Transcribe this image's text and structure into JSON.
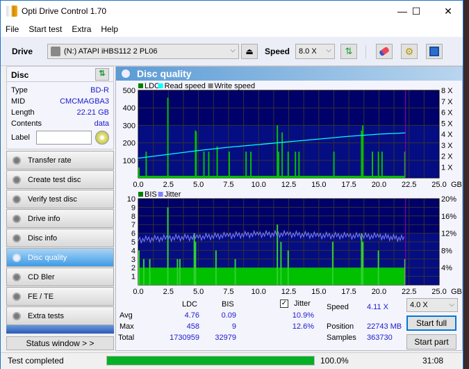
{
  "window": {
    "title": "Opti Drive Control 1.70",
    "minimize": "—",
    "maximize": "☐",
    "close": "✕"
  },
  "menu": [
    "File",
    "Start test",
    "Extra",
    "Help"
  ],
  "toolbar": {
    "drive_label": "Drive",
    "drive_value": "(N:)  ATAPI iHBS112   2 PL06",
    "speed_label": "Speed",
    "speed_value": "8.0 X"
  },
  "disc": {
    "header": "Disc",
    "rows": [
      {
        "k": "Type",
        "v": "BD-R"
      },
      {
        "k": "MID",
        "v": "CMCMAGBA3"
      },
      {
        "k": "Length",
        "v": "22.21 GB"
      },
      {
        "k": "Contents",
        "v": "data"
      }
    ],
    "label_caption": "Label",
    "label_value": ""
  },
  "nav": [
    {
      "label": "Transfer rate",
      "active": false
    },
    {
      "label": "Create test disc",
      "active": false
    },
    {
      "label": "Verify test disc",
      "active": false
    },
    {
      "label": "Drive info",
      "active": false
    },
    {
      "label": "Disc info",
      "active": false
    },
    {
      "label": "Disc quality",
      "active": true
    },
    {
      "label": "CD Bler",
      "active": false
    },
    {
      "label": "FE / TE",
      "active": false
    },
    {
      "label": "Extra tests",
      "active": false
    }
  ],
  "status_window_button": "Status window > >",
  "panel": {
    "title": "Disc quality"
  },
  "chart_data": [
    {
      "type": "bar",
      "title": "LDC",
      "legend": [
        {
          "name": "LDC",
          "color": "#008000"
        },
        {
          "name": "Read speed",
          "color": "#00ffff"
        },
        {
          "name": "Write speed",
          "color": "#808080"
        }
      ],
      "xlabel": "GB",
      "x_ticks": [
        "0.0",
        "2.5",
        "5.0",
        "7.5",
        "10.0",
        "12.5",
        "15.0",
        "17.5",
        "20.0",
        "22.5",
        "25.0"
      ],
      "xlim": [
        0,
        25
      ],
      "ylim": [
        0,
        500
      ],
      "y_ticks": [
        "500",
        "400",
        "300",
        "200",
        "100"
      ],
      "y2_ticks": [
        "8 X",
        "7 X",
        "6 X",
        "5 X",
        "4 X",
        "3 X",
        "2 X",
        "1 X"
      ],
      "y2lim": [
        0,
        8
      ],
      "end_marker_gb": 22.21,
      "ldc_spikes": [
        [
          0.0,
          60
        ],
        [
          0.6,
          150
        ],
        [
          2.4,
          458
        ],
        [
          4.7,
          270
        ],
        [
          4.75,
          265
        ],
        [
          5.4,
          150
        ],
        [
          5.8,
          150
        ],
        [
          6.5,
          180
        ],
        [
          7.5,
          150
        ],
        [
          8.9,
          150
        ],
        [
          9.3,
          150
        ],
        [
          11.5,
          300
        ],
        [
          11.6,
          150
        ],
        [
          11.9,
          260
        ],
        [
          12.4,
          150
        ],
        [
          13.0,
          150
        ],
        [
          13.3,
          150
        ],
        [
          16.2,
          150
        ],
        [
          18.5,
          270
        ],
        [
          18.6,
          300
        ],
        [
          19.4,
          150
        ],
        [
          19.9,
          150
        ],
        [
          20.2,
          150
        ],
        [
          22.1,
          150
        ]
      ],
      "ldc_baseline": 12,
      "read_speed": [
        [
          0,
          1.8
        ],
        [
          2.5,
          2.15
        ],
        [
          5,
          2.5
        ],
        [
          7.5,
          2.8
        ],
        [
          10,
          3.05
        ],
        [
          12.5,
          3.3
        ],
        [
          15,
          3.55
        ],
        [
          17.5,
          3.8
        ],
        [
          20,
          4.0
        ],
        [
          22.21,
          4.11
        ]
      ]
    },
    {
      "type": "bar",
      "title": "BIS",
      "legend": [
        {
          "name": "BIS",
          "color": "#008000"
        },
        {
          "name": "Jitter",
          "color": "#8080ff"
        }
      ],
      "xlabel": "GB",
      "x_ticks": [
        "0.0",
        "2.5",
        "5.0",
        "7.5",
        "10.0",
        "12.5",
        "15.0",
        "17.5",
        "20.0",
        "22.5",
        "25.0"
      ],
      "xlim": [
        0,
        25
      ],
      "ylim": [
        0,
        10
      ],
      "y_ticks": [
        "10",
        "9",
        "8",
        "7",
        "6",
        "5",
        "4",
        "3",
        "2",
        "1"
      ],
      "y2_ticks": [
        "20%",
        "16%",
        "12%",
        "8%",
        "4%"
      ],
      "y2lim": [
        0,
        20
      ],
      "end_marker_gb": 22.21,
      "bis_spikes": [
        [
          0.0,
          4
        ],
        [
          0.4,
          3
        ],
        [
          0.9,
          3
        ],
        [
          2.4,
          9
        ],
        [
          3.2,
          3
        ],
        [
          3.4,
          3
        ],
        [
          4.6,
          6
        ],
        [
          4.7,
          5
        ],
        [
          6.4,
          4
        ],
        [
          8.0,
          3
        ],
        [
          11.5,
          7
        ],
        [
          11.8,
          5
        ],
        [
          12.4,
          4
        ],
        [
          16.1,
          5
        ],
        [
          18.5,
          6
        ],
        [
          18.6,
          5
        ],
        [
          19.9,
          4
        ],
        [
          22.1,
          3
        ]
      ],
      "bis_baseline": 2,
      "jitter": [
        [
          0,
          10.5
        ],
        [
          2.5,
          10.9
        ],
        [
          5,
          11.1
        ],
        [
          7.5,
          11.5
        ],
        [
          10,
          11.8
        ],
        [
          12.5,
          11.8
        ],
        [
          15,
          11.5
        ],
        [
          17.5,
          11.4
        ],
        [
          20,
          11.3
        ],
        [
          22.21,
          10.7
        ]
      ]
    }
  ],
  "stats": {
    "col_ldc": "LDC",
    "col_bis": "BIS",
    "jitter_label": "Jitter",
    "jitter_checked": true,
    "rows": [
      {
        "label": "Avg",
        "ldc": "4.76",
        "bis": "0.09",
        "jitter": "10.9%"
      },
      {
        "label": "Max",
        "ldc": "458",
        "bis": "9",
        "jitter": "12.6%"
      },
      {
        "label": "Total",
        "ldc": "1730959",
        "bis": "32979",
        "jitter": ""
      }
    ],
    "speed_label": "Speed",
    "speed_value": "4.11 X",
    "position_label": "Position",
    "position_value": "22743 MB",
    "samples_label": "Samples",
    "samples_value": "363730",
    "speed_select": "4.0 X",
    "start_full": "Start full",
    "start_part": "Start part"
  },
  "status": {
    "text": "Test completed",
    "progress_pct": 100,
    "progress_text": "100.0%",
    "time": "31:08"
  },
  "colors": {
    "accent": "#1e73c8",
    "progress": "#06b025",
    "plot_bg": "#000080",
    "ldc": "#00c000",
    "read_speed": "#00ffff",
    "jitter": "#8080ff",
    "marker": "#a000a0"
  }
}
